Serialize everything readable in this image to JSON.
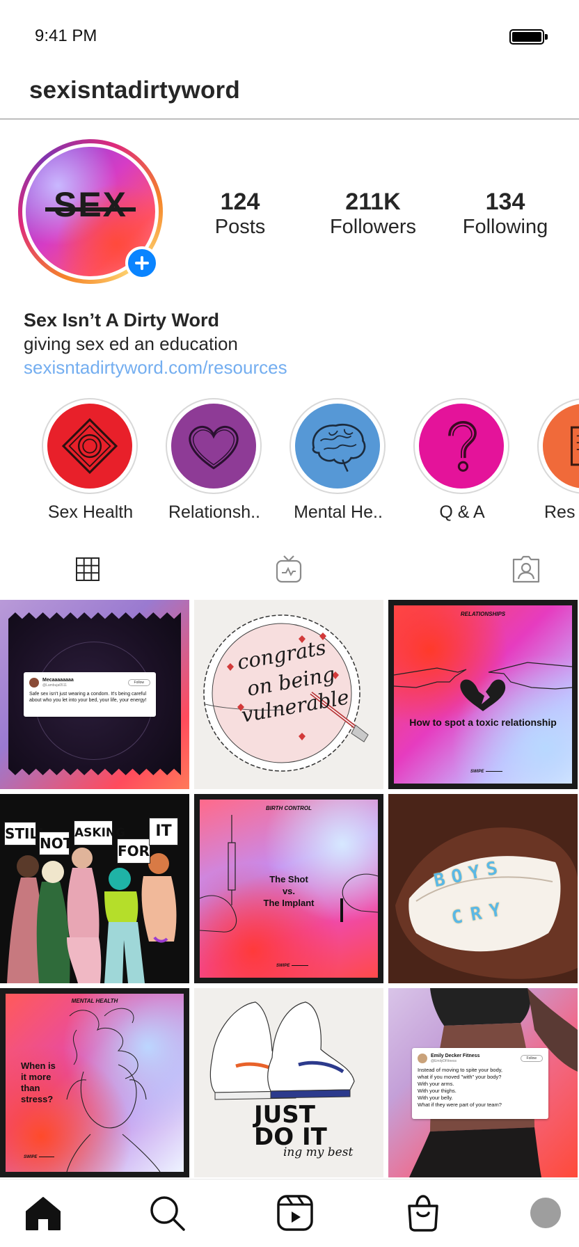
{
  "status_bar": {
    "time": "9:41 PM"
  },
  "header": {
    "username": "sexisntadirtyword"
  },
  "profile": {
    "avatar_text": "SEX",
    "stats": [
      {
        "value": "124",
        "label": "Posts"
      },
      {
        "value": "211K",
        "label": "Followers"
      },
      {
        "value": "134",
        "label": "Following"
      }
    ],
    "name": "Sex Isn’t A Dirty Word",
    "bio": "giving sex ed an education",
    "link": "sexisntadirtyword.com/resources"
  },
  "highlights": [
    {
      "label": "Sex Health",
      "color": "#e8202a",
      "icon": "condom-wrapper-icon"
    },
    {
      "label": "Relationsh..",
      "color": "#8e3b96",
      "icon": "heart-icon"
    },
    {
      "label": "Mental He..",
      "color": "#5698d6",
      "icon": "brain-icon"
    },
    {
      "label": "Q & A",
      "color": "#e4139a",
      "icon": "question-mark-icon"
    },
    {
      "label": "Res",
      "color": "#f06a3a",
      "icon": "book-icon"
    }
  ],
  "tabs": [
    {
      "name": "grid",
      "icon": "grid-icon"
    },
    {
      "name": "igtv",
      "icon": "tv-icon"
    },
    {
      "name": "tagged",
      "icon": "tagged-person-icon"
    }
  ],
  "posts": {
    "post1": {
      "tweet_name": "Mecaaaaaaaa",
      "tweet_handle": "@Lambuja0511",
      "follow": "Follow",
      "tweet_text": "Safe sex isn't just wearing a condom. It's being careful about who you let into your bed, your life, your energy!"
    },
    "post2": {
      "line1": "congrats",
      "line2": "on being",
      "line3": "vulnerable"
    },
    "post3": {
      "kicker": "RELATIONSHIPS",
      "title": "How to spot a toxic relationship",
      "swipe": "SWIPE"
    },
    "post4": {
      "signs": [
        "STILL",
        "NOT",
        "ASKING",
        "FOR",
        "IT"
      ]
    },
    "post5": {
      "kicker": "BIRTH CONTROL",
      "title_1": "The Shot",
      "title_2": "vs.",
      "title_3": "The Implant",
      "swipe": "SWIPE"
    },
    "post6": {
      "teeth_top": "BOYS",
      "teeth_bottom": "CRY"
    },
    "post7": {
      "kicker": "MENTAL HEALTH",
      "title_1": "When is",
      "title_2": "it more",
      "title_3": "than",
      "title_4": "stress?",
      "swipe": "SWIPE"
    },
    "post8": {
      "line1": "JUST",
      "line2": "DO IT",
      "line3": "ing my best"
    },
    "post9": {
      "tweet_name": "Emily Decker Fitness",
      "tweet_handle": "@EmilyDFitness",
      "follow": "Follow",
      "lines": [
        "Instead of moving to spite your body,",
        "what if you moved \"with\" your body?",
        "With your arms.",
        "With your thighs.",
        "With your belly.",
        "What if they were part of your team?"
      ]
    }
  },
  "bottom_nav": [
    {
      "name": "home",
      "icon": "home-icon"
    },
    {
      "name": "search",
      "icon": "search-icon"
    },
    {
      "name": "reels",
      "icon": "reels-icon"
    },
    {
      "name": "shop",
      "icon": "shop-bag-icon"
    },
    {
      "name": "profile",
      "icon": "profile-avatar-icon"
    }
  ]
}
